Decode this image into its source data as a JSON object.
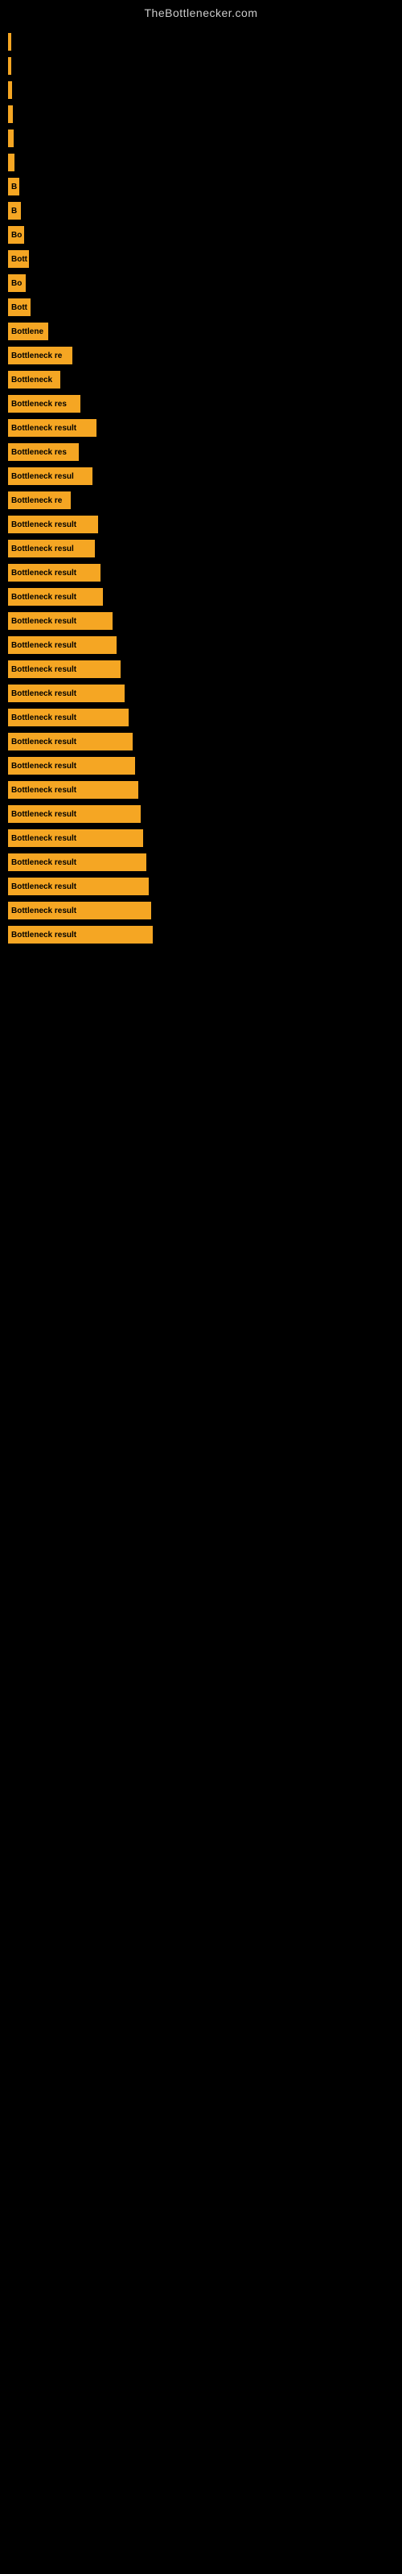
{
  "site": {
    "title": "TheBottlenecker.com"
  },
  "bars": [
    {
      "id": 1,
      "label": "",
      "width": 2
    },
    {
      "id": 2,
      "label": "",
      "width": 4
    },
    {
      "id": 3,
      "label": "",
      "width": 5
    },
    {
      "id": 4,
      "label": "",
      "width": 6
    },
    {
      "id": 5,
      "label": "",
      "width": 7
    },
    {
      "id": 6,
      "label": "",
      "width": 8
    },
    {
      "id": 7,
      "label": "B",
      "width": 14
    },
    {
      "id": 8,
      "label": "B",
      "width": 16
    },
    {
      "id": 9,
      "label": "Bo",
      "width": 20
    },
    {
      "id": 10,
      "label": "Bott",
      "width": 26
    },
    {
      "id": 11,
      "label": "Bo",
      "width": 22
    },
    {
      "id": 12,
      "label": "Bott",
      "width": 28
    },
    {
      "id": 13,
      "label": "Bottlene",
      "width": 50
    },
    {
      "id": 14,
      "label": "Bottleneck re",
      "width": 80
    },
    {
      "id": 15,
      "label": "Bottleneck",
      "width": 65
    },
    {
      "id": 16,
      "label": "Bottleneck res",
      "width": 90
    },
    {
      "id": 17,
      "label": "Bottleneck result",
      "width": 110
    },
    {
      "id": 18,
      "label": "Bottleneck res",
      "width": 88
    },
    {
      "id": 19,
      "label": "Bottleneck resul",
      "width": 105
    },
    {
      "id": 20,
      "label": "Bottleneck re",
      "width": 78
    },
    {
      "id": 21,
      "label": "Bottleneck result",
      "width": 112
    },
    {
      "id": 22,
      "label": "Bottleneck resul",
      "width": 108
    },
    {
      "id": 23,
      "label": "Bottleneck result",
      "width": 115
    },
    {
      "id": 24,
      "label": "Bottleneck result",
      "width": 118
    },
    {
      "id": 25,
      "label": "Bottleneck result",
      "width": 130
    },
    {
      "id": 26,
      "label": "Bottleneck result",
      "width": 135
    },
    {
      "id": 27,
      "label": "Bottleneck result",
      "width": 140
    },
    {
      "id": 28,
      "label": "Bottleneck result",
      "width": 145
    },
    {
      "id": 29,
      "label": "Bottleneck result",
      "width": 150
    },
    {
      "id": 30,
      "label": "Bottleneck result",
      "width": 155
    },
    {
      "id": 31,
      "label": "Bottleneck result",
      "width": 158
    },
    {
      "id": 32,
      "label": "Bottleneck result",
      "width": 162
    },
    {
      "id": 33,
      "label": "Bottleneck result",
      "width": 165
    },
    {
      "id": 34,
      "label": "Bottleneck result",
      "width": 168
    },
    {
      "id": 35,
      "label": "Bottleneck result",
      "width": 172
    },
    {
      "id": 36,
      "label": "Bottleneck result",
      "width": 175
    },
    {
      "id": 37,
      "label": "Bottleneck result",
      "width": 178
    },
    {
      "id": 38,
      "label": "Bottleneck result",
      "width": 180
    }
  ]
}
